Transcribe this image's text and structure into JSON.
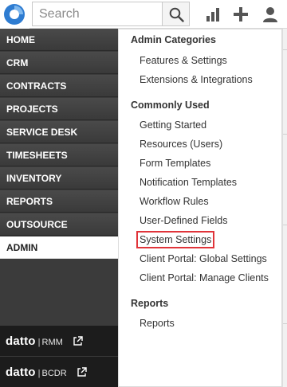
{
  "search": {
    "placeholder": "Search",
    "value": ""
  },
  "topbar": {
    "icons": [
      "analytics-icon",
      "add-icon",
      "user-icon"
    ]
  },
  "nav": {
    "items": [
      {
        "label": "HOME"
      },
      {
        "label": "CRM"
      },
      {
        "label": "CONTRACTS"
      },
      {
        "label": "PROJECTS"
      },
      {
        "label": "SERVICE DESK"
      },
      {
        "label": "TIMESHEETS"
      },
      {
        "label": "INVENTORY"
      },
      {
        "label": "REPORTS"
      },
      {
        "label": "OUTSOURCE"
      },
      {
        "label": "ADMIN"
      }
    ],
    "active": "ADMIN",
    "integrations": [
      {
        "brand": "datto",
        "sep": "|",
        "product": "RMM"
      },
      {
        "brand": "datto",
        "sep": "|",
        "product": "BCDR"
      }
    ]
  },
  "admin_menu": {
    "sections": [
      {
        "heading": "Admin Categories",
        "items": [
          "Features & Settings",
          "Extensions & Integrations"
        ]
      },
      {
        "heading": "Commonly Used",
        "items": [
          "Getting Started",
          "Resources (Users)",
          "Form Templates",
          "Notification Templates",
          "Workflow Rules",
          "User-Defined Fields",
          "System Settings",
          "Client Portal: Global Settings",
          "Client Portal: Manage Clients"
        ]
      },
      {
        "heading": "Reports",
        "items": [
          "Reports"
        ]
      }
    ],
    "highlighted_item": "System Settings"
  },
  "colors": {
    "nav_bg": "#3b3b3b",
    "highlight_border": "#e0343a",
    "logo_blue": "#2e7cd1"
  }
}
